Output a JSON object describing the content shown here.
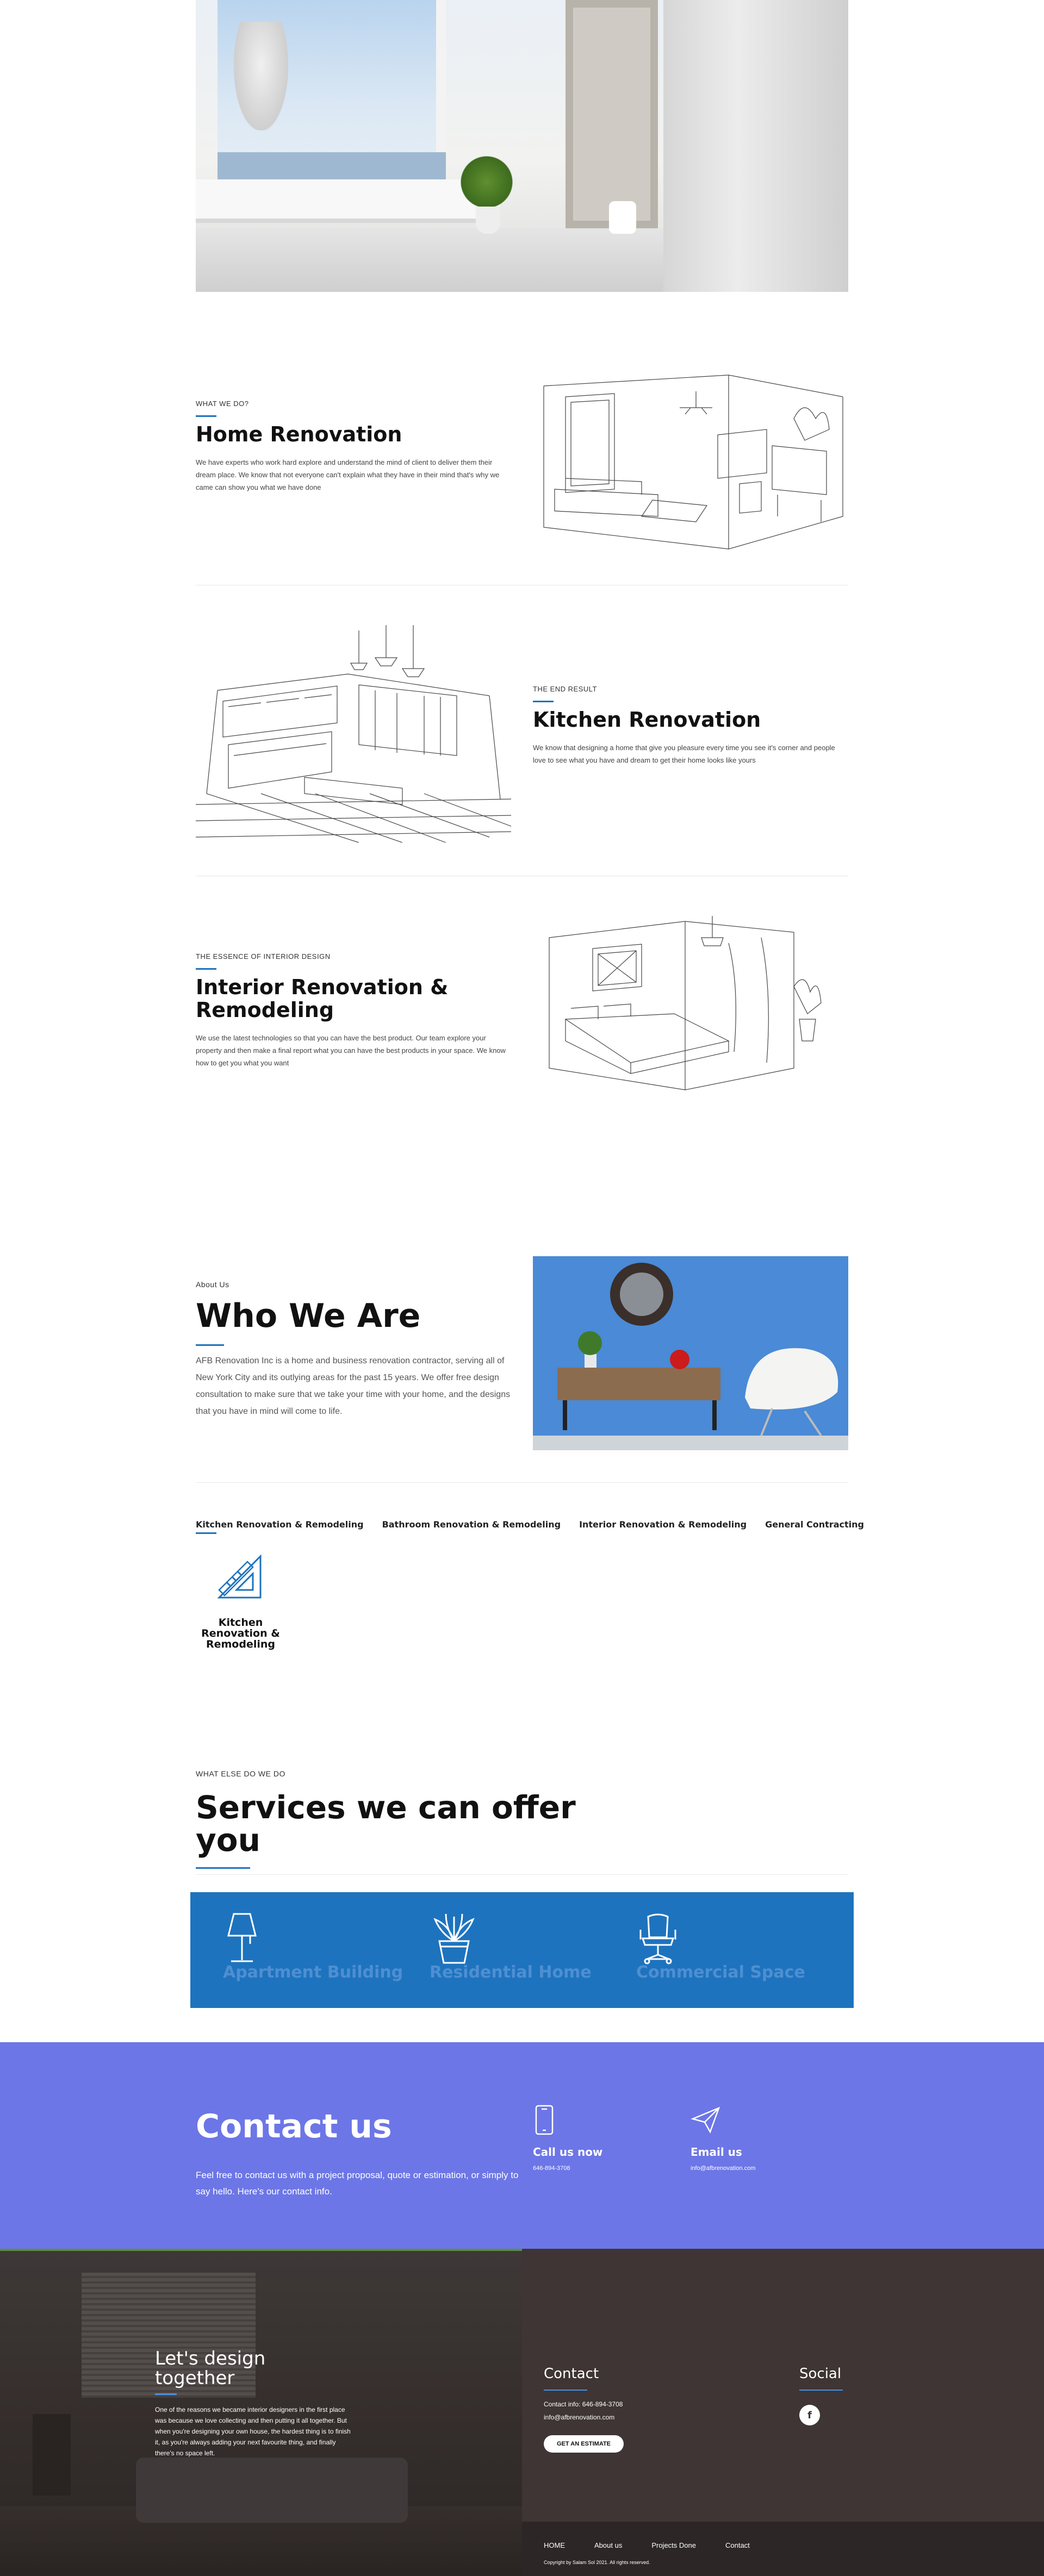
{
  "home": {
    "eyebrow": "WHAT WE DO?",
    "title": "Home Renovation",
    "text": "We have experts who work hard explore and understand the mind of client to deliver them their dream place. We know that not everyone can't explain what they have in their mind that's why we came can show you what we have done"
  },
  "kitchen": {
    "eyebrow": "THE END RESULT",
    "title": "Kitchen Renovation",
    "text": "We know that designing a home that give you pleasure every time you see it's corner and people love to see what you have and dream to get their home looks like yours"
  },
  "interior": {
    "eyebrow": "THE ESSENCE OF INTERIOR DESIGN",
    "title": "Interior Renovation & Remodeling",
    "text": "We use the latest technologies so that you can have the best product. Our team explore your property and then make a final report what you can have the best products in your space. We know how to get you what you want"
  },
  "about": {
    "eyebrow": "About Us",
    "title": "Who We Are",
    "text": "AFB Renovation Inc is a home and business renovation contractor, serving all of New York City and its outlying areas for the past 15 years. We offer free design consultation to make sure that we take your time with your home, and the designs that you have in mind will come to life."
  },
  "tabs": [
    "Kitchen Renovation & Remodeling",
    "Bathroom Renovation & Remodeling",
    "Interior Renovation & Remodeling",
    "General Contracting"
  ],
  "tab_panel": {
    "icon": "ruler-triangle-icon",
    "label": "Kitchen Renovation & Remodeling"
  },
  "services": {
    "eyebrow": "WHAT ELSE DO WE DO",
    "title": "Services we can offer you",
    "items": [
      {
        "icon": "lamp-icon",
        "label": "Apartment Building"
      },
      {
        "icon": "plant-icon",
        "label": "Residential Home"
      },
      {
        "icon": "office-chair-icon",
        "label": "Commercial Space"
      }
    ]
  },
  "contact": {
    "title": "Contact us",
    "text": "Feel free to contact us with a project proposal, quote or estimation, or simply to say hello. Here's our contact info.",
    "call_label": "Call us now",
    "call_value": "646-894-3708",
    "email_label": "Email us",
    "email_value": "info@afbrenovation.com"
  },
  "footer": {
    "design_title": "Let's design together",
    "design_text": "One of the reasons we became interior designers in the first place was because we love collecting and then putting it all together. But when you're designing your own house, the hardest thing is to finish it, as you're always adding your next favourite thing, and finally there's no space left.",
    "contact_heading": "Contact",
    "contact_info": "Contact info: 646-894-3708",
    "contact_email": "info@afbrenovation.com",
    "estimate_button": "GET AN ESTIMATE",
    "social_heading": "Social",
    "social_icon": "facebook-icon",
    "nav": [
      "HOME",
      "About us",
      "Projects Done",
      "Contact"
    ],
    "copyright": "Copyright by Salam Sol 2021. All rights reserved."
  },
  "colors": {
    "accent": "#1e73be",
    "contact_bg": "#6c76e6",
    "footer_bg": "#3e3534"
  }
}
